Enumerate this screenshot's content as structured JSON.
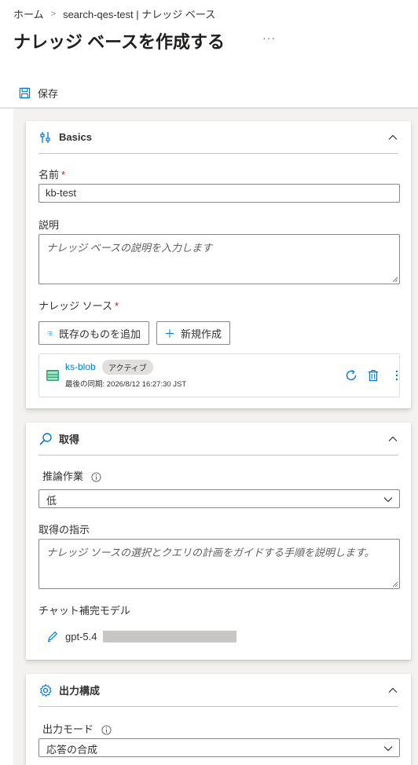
{
  "breadcrumb": {
    "home": "ホーム",
    "separator": ">",
    "current": "search-qes-test | ナレッジ ベース"
  },
  "page": {
    "title": "ナレッジ ベースを作成する",
    "more": "···"
  },
  "toolbar": {
    "save_label": "保存"
  },
  "basics": {
    "title": "Basics",
    "name_label": "名前",
    "required_mark": "*",
    "name_value": "kb-test",
    "description_label": "説明",
    "description_placeholder": "ナレッジ ベースの説明を入力します",
    "sources_label": "ナレッジ ソース",
    "add_existing_label": "既存のものを追加",
    "new_label": "新規作成",
    "source": {
      "name": "ks-blob",
      "status": "アクティブ",
      "last_sync": "最後の同期: 2026/8/12 16:27:30 JST"
    }
  },
  "retrieval": {
    "title": "取得",
    "reasoning_label": "推論作業",
    "reasoning_value": "低",
    "instructions_label": "取得の指示",
    "instructions_placeholder": "ナレッジ ソースの選択とクエリの計画をガイドする手順を説明します。",
    "model_label": "チャット補完モデル",
    "model_value": "gpt-5.4"
  },
  "output": {
    "title": "出力構成",
    "mode_label": "出力モード",
    "mode_value": "応答の合成"
  },
  "colors": {
    "accent": "#0078d4",
    "canvas": "#f3f2f1",
    "required": "#a4262c"
  }
}
